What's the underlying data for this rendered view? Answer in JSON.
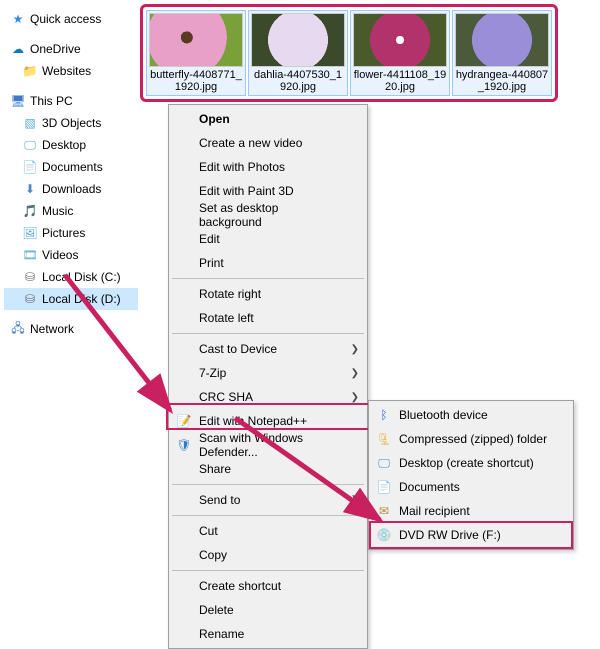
{
  "sidebar": {
    "quick_access": "Quick access",
    "onedrive": "OneDrive",
    "websites": "Websites",
    "this_pc": "This PC",
    "pc_children": [
      "3D Objects",
      "Desktop",
      "Documents",
      "Downloads",
      "Music",
      "Pictures",
      "Videos",
      "Local Disk (C:)",
      "Local Disk (D:)"
    ],
    "network": "Network"
  },
  "thumbnails": [
    {
      "label": "butterfly-4408771_1920.jpg"
    },
    {
      "label": "dahlia-4407530_1920.jpg"
    },
    {
      "label": "flower-4411108_1920.jpg"
    },
    {
      "label": "hydrangea-440807_1920.jpg"
    }
  ],
  "context_menu": {
    "open": "Open",
    "create_video": "Create a new video",
    "edit_photos": "Edit with Photos",
    "edit_paint3d": "Edit with Paint 3D",
    "set_bg": "Set as desktop background",
    "edit": "Edit",
    "print": "Print",
    "rotate_right": "Rotate right",
    "rotate_left": "Rotate left",
    "cast": "Cast to Device",
    "seven_zip": "7-Zip",
    "crc_sha": "CRC SHA",
    "notepadpp": "Edit with Notepad++",
    "defender": "Scan with Windows Defender...",
    "share": "Share",
    "send_to": "Send to",
    "cut": "Cut",
    "copy": "Copy",
    "create_shortcut": "Create shortcut",
    "delete": "Delete",
    "rename": "Rename"
  },
  "send_to_menu": {
    "bluetooth": "Bluetooth device",
    "zip": "Compressed (zipped) folder",
    "desktop_shortcut": "Desktop (create shortcut)",
    "documents": "Documents",
    "mail": "Mail recipient",
    "dvd_rw": "DVD RW Drive (F:)"
  },
  "annotation_color": "#c9215f"
}
